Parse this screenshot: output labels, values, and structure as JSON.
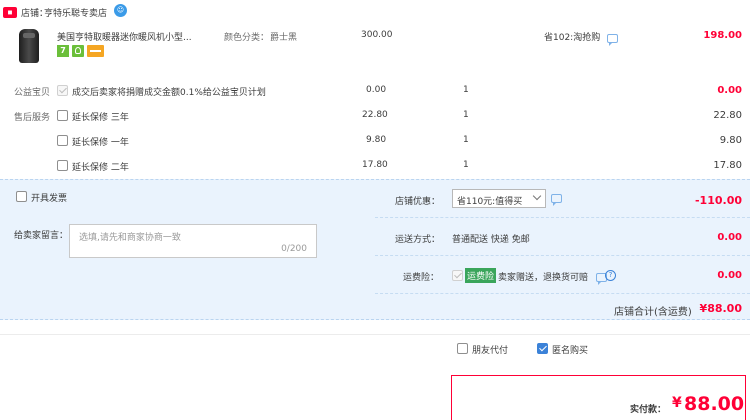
{
  "shop": {
    "label": "店铺：",
    "name": "亨特乐聪专卖店"
  },
  "product": {
    "title": "美国亨特取暖器迷你暖风机小型...",
    "spec_label": "颜色分类：",
    "spec_value": "爵士黑",
    "price": "300.00",
    "promo": "省102:淘抢购",
    "subtotal": "198.00",
    "badge_seven": "7"
  },
  "charity": {
    "label": "公益宝贝",
    "text": "成交后卖家将捐赠成交金额0.1%给公益宝贝计划",
    "price": "0.00",
    "qty": "1",
    "subtotal": "0.00"
  },
  "service_label": "售后服务",
  "services": [
    {
      "name": "延长保修 三年",
      "price": "22.80",
      "qty": "1",
      "subtotal": "22.80"
    },
    {
      "name": "延长保修 一年",
      "price": "9.80",
      "qty": "1",
      "subtotal": "9.80"
    },
    {
      "name": "延长保修 二年",
      "price": "17.80",
      "qty": "1",
      "subtotal": "17.80"
    }
  ],
  "invoice_label": "开具发票",
  "discount": {
    "label": "店铺优惠：",
    "selected": "省110元:值得买",
    "amount": "-110.00"
  },
  "message": {
    "label": "给卖家留言：",
    "placeholder": "选填,请先和商家协商一致",
    "counter": "0/200"
  },
  "delivery": {
    "label": "运送方式：",
    "value": "普通配送 快递 免邮",
    "amount": "0.00"
  },
  "insurance": {
    "label": "运费险：",
    "tag": "运费险",
    "text": "卖家赠送，退换货可赔",
    "amount": "0.00"
  },
  "shop_total": {
    "label": "店铺合计(含运费)",
    "amount": "¥88.00"
  },
  "options": {
    "friend_pay": "朋友代付",
    "anonymous": "匿名购买"
  },
  "payment": {
    "label": "实付款：",
    "amount": "88.00"
  },
  "colors": {
    "accent": "#ff0036",
    "panel": "#eaf3fd",
    "link": "#3b82d8"
  }
}
